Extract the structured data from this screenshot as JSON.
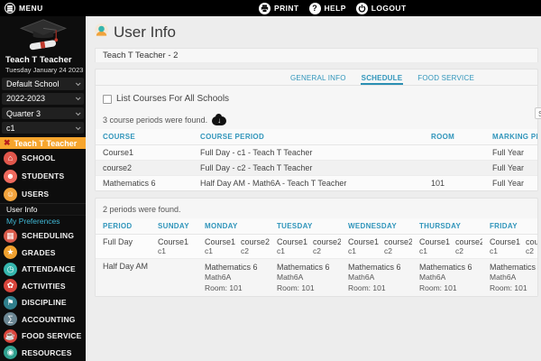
{
  "topbar": {
    "menu": "MENU",
    "print": "PRINT",
    "help": "HELP",
    "logout": "LOGOUT"
  },
  "sidebar": {
    "user_name": "Teach T Teacher",
    "date": "Tuesday January 24 2023",
    "school_select": "Default School",
    "year_select": "2022-2023",
    "term_select": "Quarter 3",
    "class_select": "c1",
    "focus_label": "Teach T Teacher",
    "focus_close_glyph": "✖",
    "menu": [
      {
        "label": "SCHOOL",
        "icon": "school-icon",
        "glyph": "⌂",
        "color": "#e2574c"
      },
      {
        "label": "STUDENTS",
        "icon": "students-icon",
        "glyph": "☻",
        "color": "#ef6a5e"
      },
      {
        "label": "USERS",
        "icon": "users-icon",
        "glyph": "☺",
        "color": "#f2a33c"
      },
      {
        "label": "SCHEDULING",
        "icon": "scheduling-icon",
        "glyph": "▦",
        "color": "#d85b4b"
      },
      {
        "label": "GRADES",
        "icon": "grades-icon",
        "glyph": "★",
        "color": "#f0a12f"
      },
      {
        "label": "ATTENDANCE",
        "icon": "attendance-icon",
        "glyph": "◷",
        "color": "#35b6ae"
      },
      {
        "label": "ACTIVITIES",
        "icon": "activities-icon",
        "glyph": "✿",
        "color": "#d9453c"
      },
      {
        "label": "DISCIPLINE",
        "icon": "discipline-icon",
        "glyph": "⚑",
        "color": "#2f7f8c"
      },
      {
        "label": "ACCOUNTING",
        "icon": "accounting-icon",
        "glyph": "∑",
        "color": "#6b8693"
      },
      {
        "label": "FOOD SERVICE",
        "icon": "food-service-icon",
        "glyph": "☕",
        "color": "#d9453c"
      },
      {
        "label": "RESOURCES",
        "icon": "resources-icon",
        "glyph": "◉",
        "color": "#2fa08f"
      }
    ],
    "sub_items": [
      {
        "label": "User Info"
      },
      {
        "label": "My Preferences"
      }
    ]
  },
  "header": {
    "title": "User Info",
    "record_tab": "Teach T Teacher - 2"
  },
  "tabs": [
    {
      "label": "GENERAL INFO"
    },
    {
      "label": "SCHEDULE"
    },
    {
      "label": "FOOD SERVICE"
    }
  ],
  "main": {
    "checkbox_label": "List Courses For All Schools",
    "courses_found": "3 course periods were found.",
    "search_partial": "S",
    "courses_table": {
      "headers": [
        "COURSE",
        "COURSE PERIOD",
        "ROOM",
        "MARKING PERIOD"
      ],
      "rows": [
        {
          "course": "Course1",
          "course_period": "Full Day - c1 - Teach T Teacher",
          "room": "",
          "marking_period": "Full Year"
        },
        {
          "course": "course2",
          "course_period": "Full Day - c2 - Teach T Teacher",
          "room": "",
          "marking_period": "Full Year"
        },
        {
          "course": "Mathematics 6",
          "course_period": "Half Day AM - Math6A - Teach T Teacher",
          "room": "101",
          "marking_period": "Full Year"
        }
      ]
    },
    "periods_found": "2 periods were found.",
    "week_table": {
      "headers": [
        "PERIOD",
        "SUNDAY",
        "MONDAY",
        "TUESDAY",
        "WEDNESDAY",
        "THURSDAY",
        "FRIDAY"
      ],
      "full_day": {
        "period": "Full Day",
        "sunday": {
          "course": "Course1",
          "section": "c1"
        },
        "weekdays": {
          "course1": "Course1",
          "section1": "c1",
          "course2": "course2",
          "section2": "c2"
        }
      },
      "half_day": {
        "period": "Half Day AM",
        "weekdays": {
          "course": "Mathematics 6",
          "section": "Math6A",
          "room": "Room: 101"
        }
      }
    }
  },
  "colors": {
    "accent-orange": "#f6a52d",
    "accent-red": "#c0392b",
    "tab-blue": "#3095bb",
    "topbar-bg": "#000000",
    "sidebar-bg": "#0d0d0d",
    "content-bg": "#ededed",
    "panel-bg": "#f6f6f6"
  }
}
